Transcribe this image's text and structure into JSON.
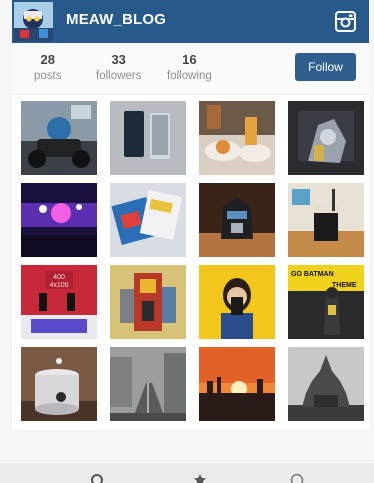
{
  "profile": {
    "username": "MEAW_BLOG"
  },
  "stats": {
    "posts": {
      "value": "28",
      "label": "posts"
    },
    "followers": {
      "value": "33",
      "label": "followers"
    },
    "following": {
      "value": "16",
      "label": "following"
    }
  },
  "actions": {
    "follow_label": "Follow"
  },
  "colors": {
    "header_bg": "#27598a",
    "follow_button": "#2f5f8f"
  },
  "icons": {
    "header_right": "instagram-icon",
    "bottom_bar": [
      "search-icon",
      "star-icon",
      "circle-icon"
    ]
  },
  "photos": [
    "motorcycle-figure",
    "two-phones",
    "dessert-plates",
    "robot-toy",
    "concert-stage",
    "sticker-box",
    "transformer-head",
    "iced-coffee",
    "stage-display",
    "robot-model",
    "girl-with-phone",
    "batman-figure",
    "coffee-pot",
    "city-street",
    "sunset",
    "temple-silhouette"
  ]
}
